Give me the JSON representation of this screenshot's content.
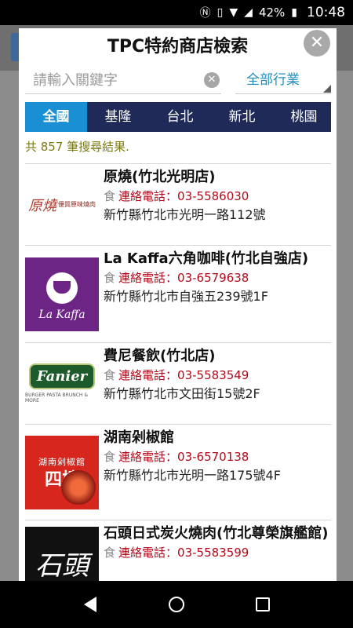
{
  "status_bar": {
    "nfc_icon": "nfc-icon",
    "vibrate_icon": "vibrate-icon",
    "wifi_icon": "wifi-icon",
    "signal_icon": "signal-icon",
    "battery_percent": "42%",
    "battery_icon": "battery-icon",
    "time": "10:48"
  },
  "dialog": {
    "title": "TPC特約商店檢索",
    "close_label": "✕"
  },
  "search": {
    "placeholder": "請輸入關鍵字",
    "value": "",
    "clear_label": "✕",
    "category_selected": "全部行業"
  },
  "region_tabs": [
    {
      "label": "全國",
      "active": true
    },
    {
      "label": "基隆",
      "active": false
    },
    {
      "label": "台北",
      "active": false
    },
    {
      "label": "新北",
      "active": false
    },
    {
      "label": "桃園",
      "active": false
    }
  ],
  "result_count_text": "共 857 筆搜尋結果.",
  "stores": [
    {
      "name": "原燒(竹北光明店)",
      "category_icon": "食",
      "phone_label": "連絡電話：",
      "phone": "03-5586030",
      "address": "新竹縣竹北市光明一路112號",
      "logo_text": "原燒",
      "logo_sub": "優質原味燒肉"
    },
    {
      "name": "La Kaffa六角咖啡(竹北自強店)",
      "category_icon": "食",
      "phone_label": "連絡電話：",
      "phone": "03-6579638",
      "address": "新竹縣竹北市自強五239號1F",
      "logo_text": "La Kaffa"
    },
    {
      "name": "費尼餐飲(竹北店)",
      "category_icon": "食",
      "phone_label": "連絡電話：",
      "phone": "03-5583549",
      "address": "新竹縣竹北市文田街15號2F",
      "logo_text": "Fanier",
      "logo_sub": "BURGER PASTA BRUNCH & MORE"
    },
    {
      "name": "湖南剁椒館",
      "category_icon": "食",
      "phone_label": "連絡電話：",
      "phone": "03-6570138",
      "address": "新竹縣竹北市光明一路175號4F",
      "logo_text": "湖南剁椒館",
      "logo_sub": "四樓"
    },
    {
      "name": "石頭日式炭火燒肉(竹北尊榮旗艦館)",
      "category_icon": "食",
      "phone_label": "連絡電話：",
      "phone": "03-5583599",
      "address": "",
      "logo_text": "石頭"
    }
  ],
  "nav": {
    "back_icon": "back-icon",
    "home_icon": "home-icon",
    "recents_icon": "recents-icon"
  }
}
